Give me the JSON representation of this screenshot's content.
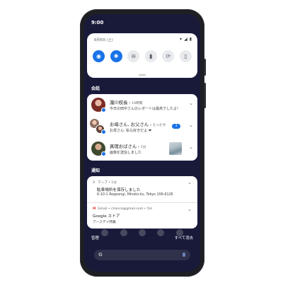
{
  "statusbar": {
    "time": "9:00",
    "icons": [
      "wifi-icon",
      "signal-icon",
      "battery-icon"
    ]
  },
  "quick_settings": {
    "date": "8月8日 (土)",
    "right_icons": [
      "wifi-icon",
      "signal-icon",
      "battery-icon"
    ],
    "tiles": [
      {
        "name": "wifi-icon",
        "glyph": "◉",
        "on": true
      },
      {
        "name": "bluetooth-icon",
        "glyph": "✱",
        "on": true
      },
      {
        "name": "dnd-icon",
        "glyph": "⊖",
        "on": false
      },
      {
        "name": "flashlight-icon",
        "glyph": "▮",
        "on": false
      },
      {
        "name": "rotate-icon",
        "glyph": "⟳",
        "on": false
      },
      {
        "name": "battery-saver-icon",
        "glyph": "▯",
        "on": false
      }
    ]
  },
  "conversations": {
    "label": "会話",
    "items": [
      {
        "title": "瀧川校長",
        "meta": " • 10時間",
        "message": "今日の田中さんのレポートは最高でしたよ!"
      },
      {
        "title": "お母さん, お父さん",
        "meta": " • たった今",
        "message": "お母さん: 私も好きだよ ❤",
        "count": "3"
      },
      {
        "title": "真理おばさん",
        "meta": " • 1分",
        "message": "画像を送信しました"
      }
    ]
  },
  "notifications": {
    "label": "通知",
    "items": [
      {
        "app": "マップ",
        "time": " • 1分",
        "title": "駐車場所を保存しました",
        "text": "6-10-1 Roppongi, Minato-ku, Tokyo 106-6126"
      },
      {
        "app": "Gmail",
        "account": " • chance@gmail.com",
        "time": " • 5m",
        "title": "Google ストア",
        "text": "アースデイ特集"
      }
    ]
  },
  "footer": {
    "manage": "管理",
    "clear_all": "すべて消去"
  },
  "colors": {
    "accent": "#1a73e8",
    "screen_bg": "#191a3a",
    "card_bg": "#ffffff"
  }
}
